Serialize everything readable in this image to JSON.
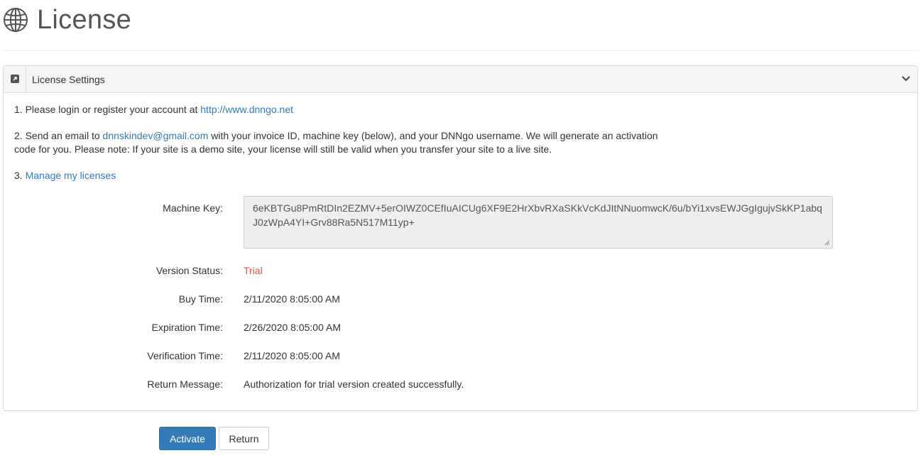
{
  "header": {
    "title": "License",
    "icon": "globe-icon"
  },
  "panel": {
    "title": "License Settings",
    "toggle_icon": "edit-square-icon",
    "collapse_icon": "chevron-down-icon"
  },
  "steps": {
    "step1_prefix": "1. Please login or register your account at ",
    "step1_link": "http://www.dnngo.net",
    "step2_prefix": "2. Send an email to ",
    "step2_email": "dnnskindev@gmail.com",
    "step2_line1_suffix": " with your invoice ID, machine key (below), and your DNNgo username. We will generate an activation",
    "step2_line2": "code for you. Please note: If your site is a demo site, your license will still be valid when you transfer your site to a live site.",
    "step3_prefix": "3. ",
    "step3_link": "Manage my licenses"
  },
  "fields": {
    "machine_key_label": "Machine Key:",
    "machine_key_value": "6eKBTGu8PmRtDIn2EZMV+5erOIWZ0CEfIuAICUg6XF9E2HrXbvRXaSKkVcKdJItNNuomwcK/6u/bYi1xvsEWJGgIgujvSkKP1abqJ0zWpA4YI+Grv88Ra5N517M11yp+",
    "version_status_label": "Version Status:",
    "version_status_value": "Trial",
    "buy_time_label": "Buy Time:",
    "buy_time_value": "2/11/2020 8:05:00 AM",
    "expiration_time_label": "Expiration Time:",
    "expiration_time_value": "2/26/2020 8:05:00 AM",
    "verification_time_label": "Verification Time:",
    "verification_time_value": "2/11/2020 8:05:00 AM",
    "return_message_label": "Return Message:",
    "return_message_value": "Authorization for trial version created successfully."
  },
  "buttons": {
    "activate": "Activate",
    "return": "Return"
  },
  "colors": {
    "primary": "#337ab7",
    "danger": "#d9534f",
    "link": "#337ab7"
  }
}
